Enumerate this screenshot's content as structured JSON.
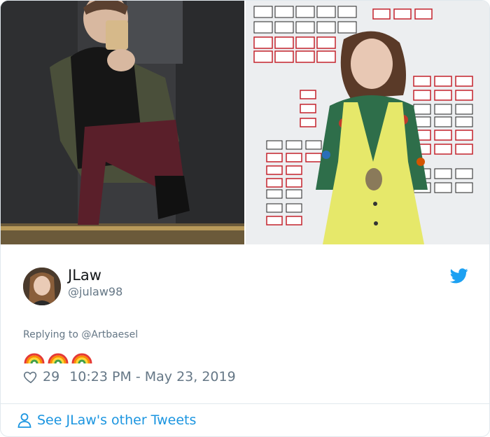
{
  "tweet": {
    "author_name": "JLaw",
    "author_handle": "@julaw98",
    "reply_prefix": "Replying to",
    "reply_to": "@Artbaesel",
    "emoji_text": "🌈🌈🌈",
    "like_count": "29",
    "timestamp": "10:23 PM - May 23, 2019"
  },
  "footer": {
    "label": "See JLaw's other Tweets"
  },
  "images": {
    "left_alt": "mirror-selfie-photo",
    "right_alt": "yellow-dress-photo"
  },
  "colors": {
    "brand_blue": "#1da1f2",
    "link_blue": "#1b95e0",
    "muted_gray": "#657786",
    "text_dark": "#14171a"
  }
}
